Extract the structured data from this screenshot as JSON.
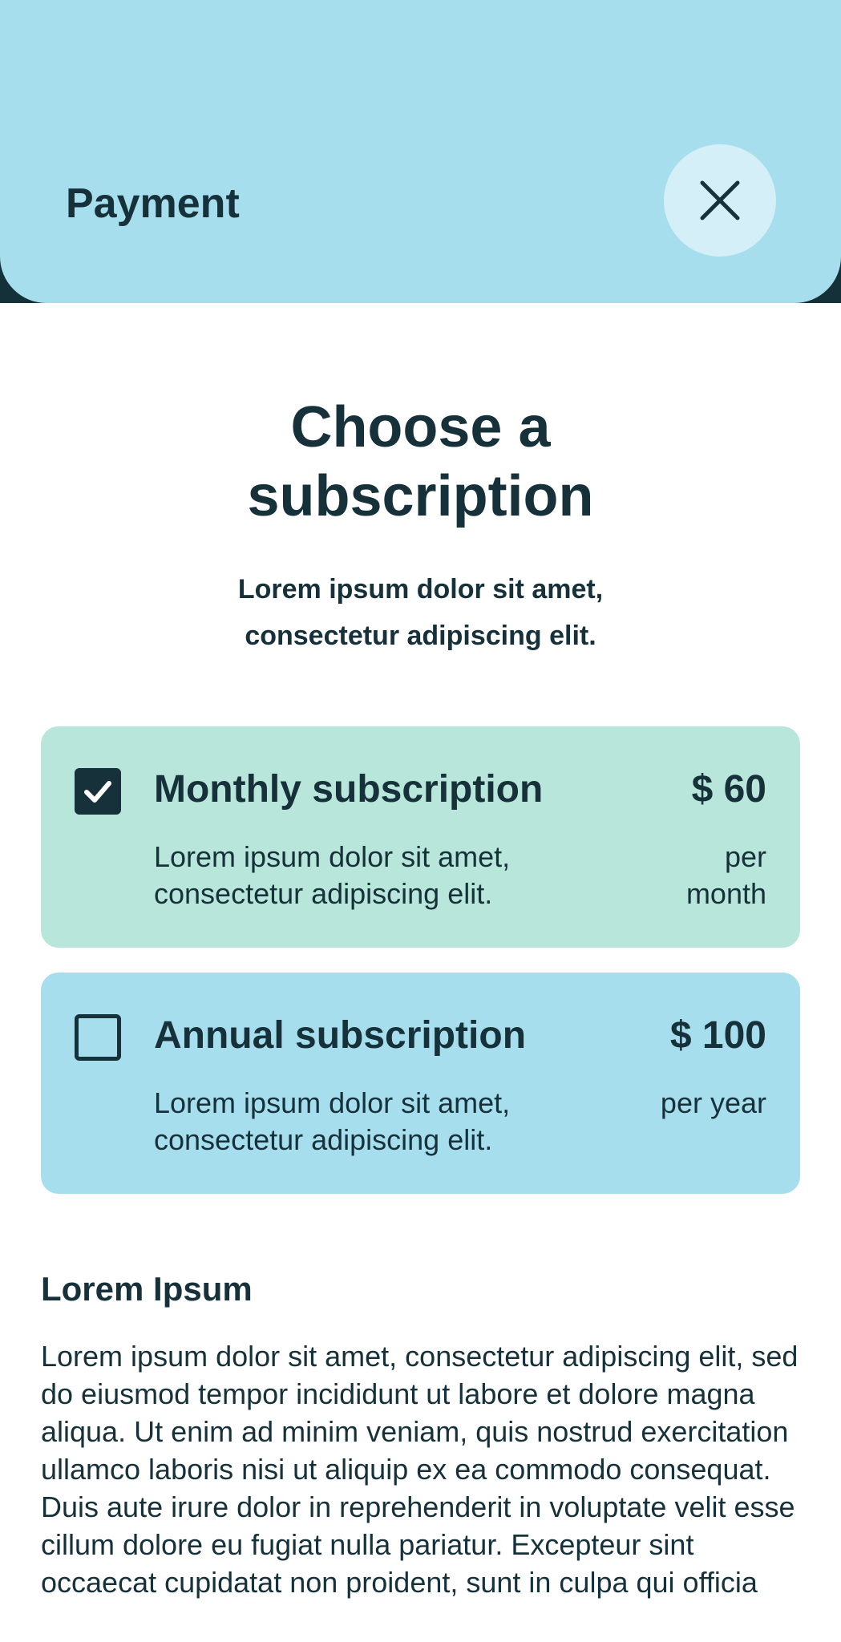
{
  "header": {
    "title": "Payment",
    "close_icon": "close-icon"
  },
  "intro": {
    "title": "Choose a subscription",
    "subtitle": "Lorem ipsum dolor sit amet, consectetur adipiscing elit."
  },
  "plans": [
    {
      "name": "Monthly subscription",
      "description": "Lorem ipsum dolor sit amet, consectetur adipiscing elit.",
      "price": "$ 60",
      "period": "per month",
      "selected": true,
      "color": "#b8e6da"
    },
    {
      "name": "Annual subscription",
      "description": "Lorem ipsum dolor sit amet, consectetur adipiscing elit.",
      "price": "$ 100",
      "period": "per year",
      "selected": false,
      "color": "#a6deed"
    }
  ],
  "info": {
    "heading": "Lorem Ipsum",
    "body": "Lorem ipsum dolor sit amet, consectetur adipiscing elit, sed do eiusmod tempor incididunt ut labore et dolore magna aliqua. Ut enim ad minim veniam, quis nostrud exercitation ullamco laboris nisi ut aliquip ex ea commodo consequat. Duis aute irure dolor in reprehenderit in voluptate velit esse cillum dolore eu fugiat nulla pariatur. Excepteur sint occaecat cupidatat non proident, sunt in culpa qui officia"
  },
  "colors": {
    "header_bg": "#a6deed",
    "header_shadow": "#143038",
    "close_button_bg": "#d4eff7",
    "monthly_card": "#b8e6da",
    "annual_card": "#a6deed",
    "text": "#17313a"
  }
}
